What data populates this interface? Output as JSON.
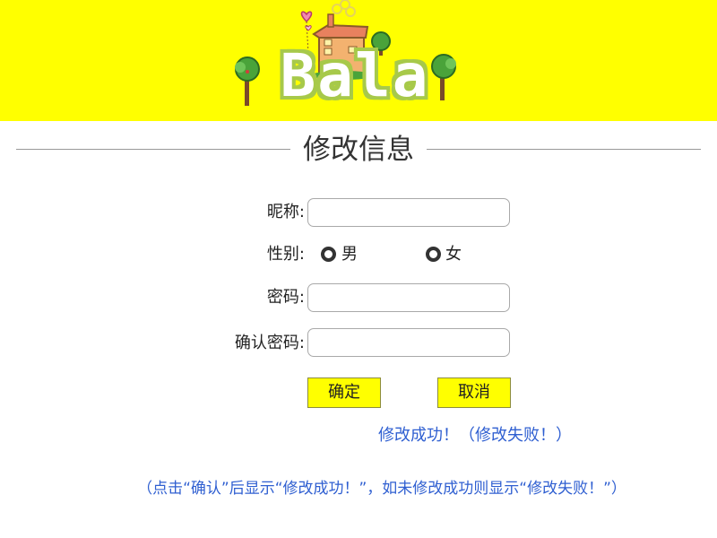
{
  "header": {
    "logo_text": "Bala",
    "background_color": "#ffff00"
  },
  "page": {
    "title": "修改信息"
  },
  "form": {
    "nickname_label": "昵称:",
    "nickname_value": "",
    "gender_label": "性别:",
    "gender_options": [
      "男",
      "女"
    ],
    "password_label": "密码:",
    "password_value": "",
    "confirm_password_label": "确认密码:",
    "confirm_password_value": ""
  },
  "buttons": {
    "confirm_label": "确定",
    "cancel_label": "取消",
    "color": "#ffff00"
  },
  "status": {
    "message": "修改成功！（修改失败！）",
    "note": "（点击“确认”后显示“修改成功！”，如未修改成功则显示“修改失败！”）",
    "color": "#2f5fd1"
  }
}
